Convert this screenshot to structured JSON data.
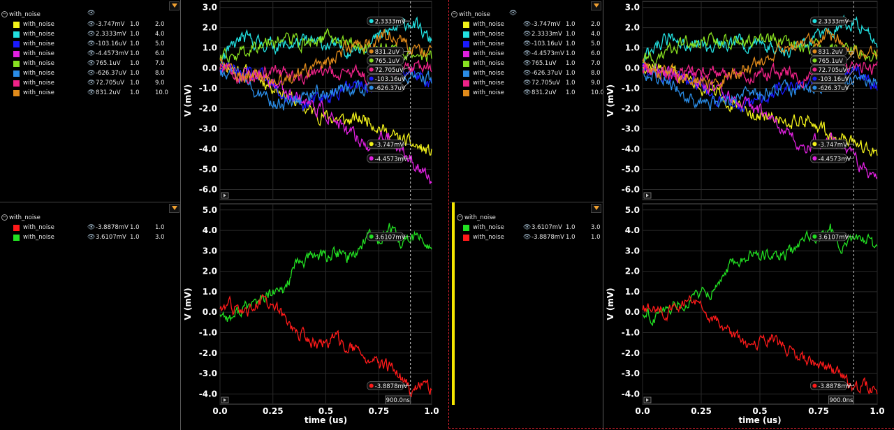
{
  "colors": {
    "background": "#000000",
    "grid": "#2a2a2a",
    "axis_text": "#ffffff",
    "cursor": "#cccccc"
  },
  "legend_top": {
    "group": "with_noise",
    "items": [
      {
        "name": "with_noise",
        "color": "#f2f21a",
        "value": "-3.747mV",
        "scale": "1.0",
        "index": "2.0"
      },
      {
        "name": "with_noise",
        "color": "#22e0e0",
        "value": "2.3333mV",
        "scale": "1.0",
        "index": "4.0"
      },
      {
        "name": "with_noise",
        "color": "#1a1aff",
        "value": "-103.16uV",
        "scale": "1.0",
        "index": "5.0"
      },
      {
        "name": "with_noise",
        "color": "#e020e0",
        "value": "-4.4573mV",
        "scale": "1.0",
        "index": "6.0"
      },
      {
        "name": "with_noise",
        "color": "#88e020",
        "value": "765.1uV",
        "scale": "1.0",
        "index": "7.0"
      },
      {
        "name": "with_noise",
        "color": "#2a8ce6",
        "value": "-626.37uV",
        "scale": "1.0",
        "index": "8.0"
      },
      {
        "name": "with_noise",
        "color": "#ee2288",
        "value": "72.705uV",
        "scale": "1.0",
        "index": "9.0"
      },
      {
        "name": "with_noise",
        "color": "#e08a1a",
        "value": "831.2uV",
        "scale": "1.0",
        "index": "10.0"
      }
    ]
  },
  "legend_bottom_left": {
    "group": "with_noise",
    "items": [
      {
        "name": "with_noise",
        "color": "#ff1a1a",
        "value": "-3.8878mV",
        "scale": "1.0",
        "index": "1.0"
      },
      {
        "name": "with_noise",
        "color": "#22e022",
        "value": "3.6107mV",
        "scale": "1.0",
        "index": "3.0"
      }
    ]
  },
  "legend_bottom_right": {
    "group": "with_noise",
    "items": [
      {
        "name": "with_noise",
        "color": "#22e022",
        "value": "3.6107mV",
        "scale": "1.0",
        "index": "3.0"
      },
      {
        "name": "with_noise",
        "color": "#ff1a1a",
        "value": "-3.8878mV",
        "scale": "1.0",
        "index": "1.0"
      }
    ]
  },
  "axes": {
    "ylabel": "V (mV)",
    "xlabel": "time (us)",
    "x_ticks": [
      "0.0",
      "0.25",
      "0.5",
      "0.75",
      "1.0"
    ],
    "top_y_ticks": [
      "3.0",
      "2.0",
      "1.0",
      "0.0",
      "-1.0",
      "-2.0",
      "-3.0",
      "-4.0",
      "-5.0",
      "-6.0"
    ],
    "bottom_y_ticks": [
      "5.0",
      "4.0",
      "3.0",
      "2.0",
      "1.0",
      "0.0",
      "-1.0",
      "-2.0",
      "-3.0",
      "-4.0"
    ],
    "cursor_label": "900.0ns"
  },
  "chart_data": [
    {
      "type": "line",
      "xlabel": "time (us)",
      "ylabel": "V (mV)",
      "xlim": [
        0,
        1.0
      ],
      "ylim": [
        -6.5,
        3.3
      ],
      "cursor_x": 0.9,
      "x": [
        0,
        0.1,
        0.2,
        0.3,
        0.4,
        0.5,
        0.6,
        0.7,
        0.8,
        0.9,
        1.0
      ],
      "series": [
        {
          "name": "with_noise",
          "color": "#f2f21a",
          "cursor_value": "-3.747mV",
          "values": [
            0.2,
            -0.1,
            -0.6,
            -1.2,
            -2.0,
            -2.4,
            -2.6,
            -2.5,
            -3.3,
            -3.75,
            -4.2
          ]
        },
        {
          "name": "with_noise",
          "color": "#22e0e0",
          "cursor_value": "2.3333mV",
          "values": [
            0.3,
            1.5,
            1.2,
            1.1,
            1.3,
            1.2,
            0.9,
            1.2,
            1.8,
            2.33,
            1.3
          ]
        },
        {
          "name": "with_noise",
          "color": "#1a1aff",
          "cursor_value": "-103.16uV",
          "values": [
            0.1,
            -0.3,
            -0.5,
            -1.4,
            -1.8,
            -1.5,
            -1.0,
            -0.9,
            -0.5,
            -0.1,
            -0.8
          ]
        },
        {
          "name": "with_noise",
          "color": "#e020e0",
          "cursor_value": "-4.4573mV",
          "values": [
            0.0,
            -0.2,
            -0.5,
            -1.0,
            -1.6,
            -2.2,
            -3.2,
            -3.8,
            -3.4,
            -4.46,
            -5.6
          ]
        },
        {
          "name": "with_noise",
          "color": "#88e020",
          "cursor_value": "765.1uV",
          "values": [
            0.3,
            0.8,
            1.3,
            1.5,
            1.2,
            1.5,
            1.3,
            0.9,
            1.0,
            0.77,
            0.5
          ]
        },
        {
          "name": "with_noise",
          "color": "#2a8ce6",
          "cursor_value": "-626.37uV",
          "values": [
            -0.2,
            -0.5,
            -1.5,
            -1.8,
            -1.3,
            -1.2,
            -1.0,
            -1.1,
            -0.7,
            -0.63,
            -0.5
          ]
        },
        {
          "name": "with_noise",
          "color": "#ee2288",
          "cursor_value": "72.705uV",
          "values": [
            0.1,
            -0.5,
            -0.3,
            -0.2,
            -0.4,
            -0.3,
            -0.2,
            -0.5,
            -0.2,
            0.07,
            0.0
          ]
        },
        {
          "name": "with_noise",
          "color": "#e08a1a",
          "cursor_value": "831.2uV",
          "values": [
            0.2,
            -0.3,
            -0.5,
            -0.7,
            -0.3,
            0.3,
            1.0,
            1.2,
            1.7,
            0.83,
            0.9
          ]
        }
      ]
    },
    {
      "type": "line",
      "xlabel": "time (us)",
      "ylabel": "V (mV)",
      "xlim": [
        0,
        1.0
      ],
      "ylim": [
        -4.5,
        5.3
      ],
      "cursor_x": 0.9,
      "x": [
        0,
        0.05,
        0.1,
        0.15,
        0.2,
        0.25,
        0.3,
        0.35,
        0.4,
        0.45,
        0.5,
        0.55,
        0.6,
        0.65,
        0.7,
        0.75,
        0.8,
        0.85,
        0.9,
        0.95,
        1.0
      ],
      "series": [
        {
          "name": "with_noise",
          "color": "#22e022",
          "cursor_value": "3.6107mV",
          "values": [
            0.0,
            -0.3,
            0.1,
            0.4,
            0.6,
            0.9,
            1.0,
            2.2,
            2.5,
            2.8,
            2.7,
            2.9,
            2.7,
            3.0,
            3.8,
            3.6,
            4.1,
            3.3,
            3.61,
            3.7,
            3.1
          ]
        },
        {
          "name": "with_noise",
          "color": "#ff1a1a",
          "cursor_value": "-3.8878mV",
          "values": [
            0.1,
            0.3,
            0.0,
            0.2,
            0.5,
            0.3,
            -0.2,
            -0.9,
            -1.2,
            -1.6,
            -1.5,
            -1.3,
            -1.6,
            -2.0,
            -2.3,
            -2.6,
            -2.7,
            -3.1,
            -3.89,
            -3.6,
            -3.7
          ]
        }
      ]
    }
  ]
}
